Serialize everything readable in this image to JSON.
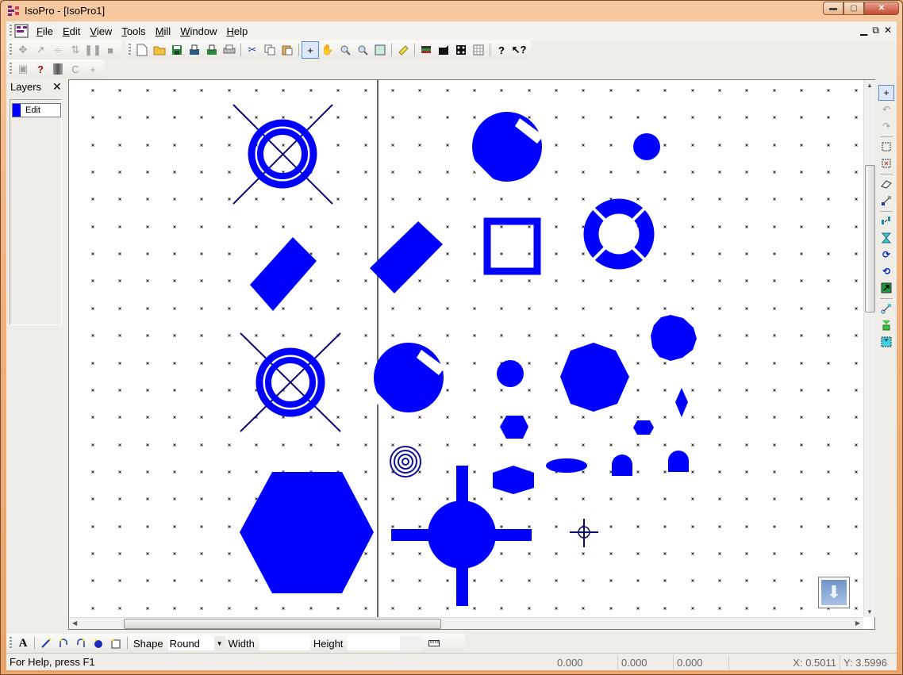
{
  "window": {
    "title": "IsoPro - [IsoPro1]",
    "controls": {
      "minimize": "minimize",
      "maximize": "maximize",
      "close": "close"
    }
  },
  "menubar": {
    "items": [
      {
        "label": "File",
        "accel": "F"
      },
      {
        "label": "Edit",
        "accel": "E"
      },
      {
        "label": "View",
        "accel": "V"
      },
      {
        "label": "Tools",
        "accel": "T"
      },
      {
        "label": "Mill",
        "accel": "M"
      },
      {
        "label": "Window",
        "accel": "W"
      },
      {
        "label": "Help",
        "accel": "H"
      }
    ],
    "mdi_controls": {
      "minimize": "‗",
      "restore": "🗗",
      "close": "✕"
    }
  },
  "toolbars": {
    "edit_tools": [
      "move-icon",
      "line-arrow-icon",
      "drag-icon",
      "flip-icon",
      "pause-icon",
      "stop-icon"
    ],
    "file_tools": [
      "new-file-icon",
      "open-folder-icon",
      "save-icon",
      "export-icon",
      "import-icon",
      "print-icon"
    ],
    "clipboard_tools": [
      "cut-icon",
      "copy-icon",
      "paste-icon"
    ],
    "view_tools": [
      "crosshair-icon",
      "pan-hand-icon",
      "zoom-in-icon",
      "zoom-out-icon",
      "zoom-fit-icon"
    ],
    "measure_tools": [
      "ruler-icon"
    ],
    "layer_tools": [
      "layers-icon",
      "pad-icon",
      "array-icon",
      "table-icon"
    ],
    "help_tools": [
      "help-icon",
      "context-help-icon"
    ],
    "aux_tools": [
      "render-icon",
      "help-info-icon",
      "gradient-icon",
      "c-label",
      "plus-icon"
    ],
    "c_label": "C",
    "plus_label": "+"
  },
  "layers": {
    "title": "Layers",
    "close": "✕",
    "items": [
      {
        "name": "Edit",
        "color": "#0000ff"
      }
    ]
  },
  "right_toolbar": [
    "select-crosshair-icon",
    "undo-icon",
    "redo-icon",
    "select-rect-icon",
    "deselect-rect-icon",
    "eraser-icon",
    "connect-icon",
    "align-icon",
    "hourglass-flip-icon",
    "rotate-cw-icon",
    "rotate-ccw-icon",
    "export-arrow-icon",
    "node-link-icon",
    "funnel-down-icon",
    "funnel-select-icon"
  ],
  "canvas": {
    "shape_color": "#0000ff",
    "line_color": "#0a0a6e",
    "divider_present": true
  },
  "bottom_toolbar": {
    "text_tool": "A",
    "draw_tools": [
      "line-draw-icon",
      "arc-cw-icon",
      "arc-ccw-icon",
      "circle-draw-icon",
      "rect-draw-icon"
    ],
    "shape_label": "Shape",
    "shape_value": "Round",
    "width_label": "Width",
    "width_value": "",
    "height_label": "Height",
    "height_value": ""
  },
  "statusbar": {
    "help_text": "For Help, press F1",
    "values": [
      "0.000",
      "0.000",
      "0.000"
    ],
    "x_readout": "X: 0.5011",
    "y_readout": "Y: 3.5996"
  },
  "colors": {
    "accent": "#0000ff",
    "titlebar": "#f0b27e",
    "active_tool": "#dce8f8"
  }
}
